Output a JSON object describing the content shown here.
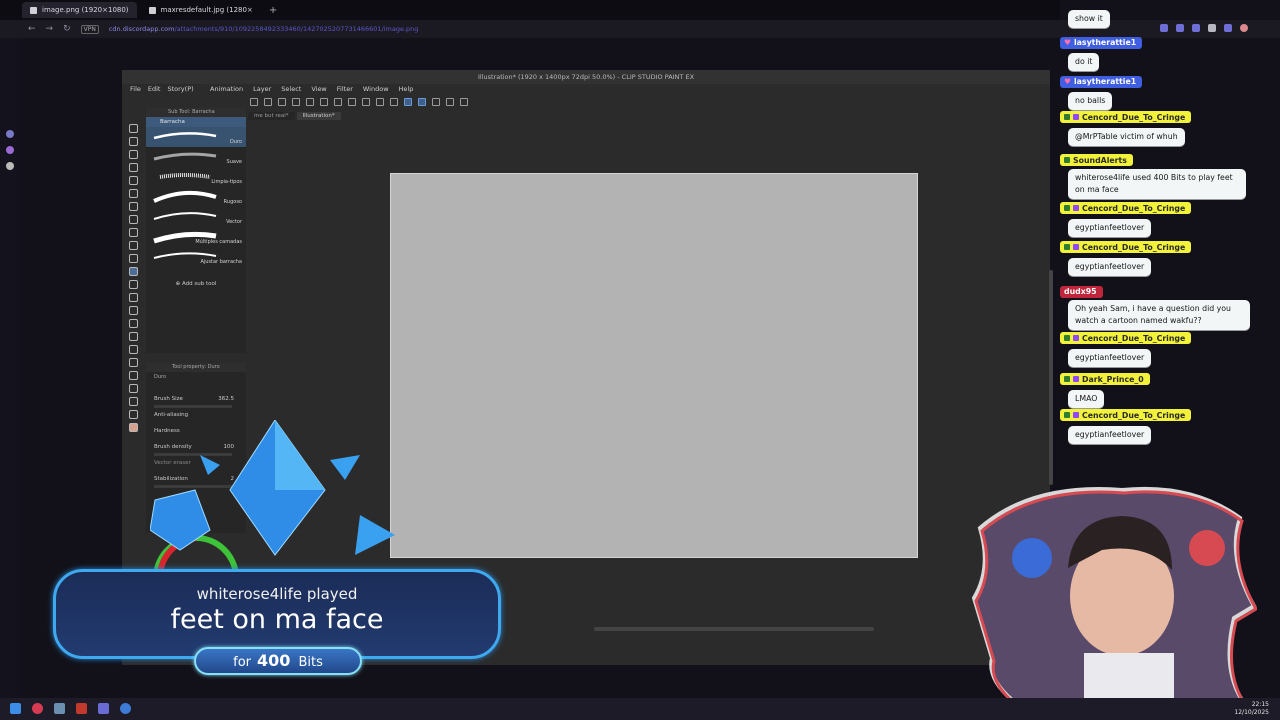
{
  "browser": {
    "tabs": [
      {
        "label": "image.png (1920×1080)",
        "active": true
      },
      {
        "label": "maxresdefault.jpg (1280×",
        "active": false
      }
    ],
    "new_tab": "+",
    "vpn_label": "VPN",
    "url_host": "cdn.discordapp.com",
    "url_path": "/attachments/910/1092258492333460/1427025207731466601/image.png"
  },
  "csp": {
    "title": "Illustration* (1920 x 1400px 72dpi 50.0%) - CLIP STUDIO PAINT EX",
    "menu": [
      "File",
      "Edit",
      "Story(P)",
      "Animation",
      "Layer",
      "Select",
      "View",
      "Filter",
      "Window",
      "Help"
    ],
    "doc_tabs": [
      "me but real*",
      "Illustration*"
    ],
    "subtool_header": "Sub Tool: Barracha",
    "subtool_group": "Barracha",
    "brushes": [
      "Duro",
      "Suave",
      "Limpia-tipos",
      "Rugoso",
      "Vector",
      "Múltiples camadas",
      "Ajustar barracha"
    ],
    "add_sub_tool": "Add sub tool",
    "tool_property_header": "Tool property: Duro",
    "tool_property_preset": "Duro",
    "props": {
      "brush_size_label": "Brush Size",
      "brush_size_value": "362.5",
      "anti_aliasing_label": "Anti-aliasing",
      "hardness_label": "Hardness",
      "brush_density_label": "Brush density",
      "brush_density_value": "100",
      "vector_eraser_label": "Vector eraser",
      "stabilization_label": "Stabilization",
      "stabilization_value": "2"
    }
  },
  "chat": {
    "messages": [
      {
        "user": "",
        "text": "show it",
        "style": "blue"
      },
      {
        "user": "lasytherattie1",
        "text": "do it",
        "style": "blue"
      },
      {
        "user": "lasytherattie1",
        "text": "no balls",
        "style": "blue"
      },
      {
        "user": "Cencord_Due_To_Cringe",
        "text": "@MrPTable victim of whuh",
        "style": "yellow"
      },
      {
        "user": "SoundAlerts",
        "text": "whiterose4life used 400 Bits to play feet on ma face",
        "style": "yellow"
      },
      {
        "user": "Cencord_Due_To_Cringe",
        "text": "egyptianfeetlover",
        "style": "yellow"
      },
      {
        "user": "Cencord_Due_To_Cringe",
        "text": "egyptianfeetlover",
        "style": "yellow"
      },
      {
        "user": "dudx95",
        "text": "Oh yeah Sam, i have a question did you watch a cartoon named wakfu??",
        "style": "red"
      },
      {
        "user": "Cencord_Due_To_Cringe",
        "text": "egyptianfeetlover",
        "style": "yellow"
      },
      {
        "user": "Dark_Prince_0",
        "text": "LMAO",
        "style": "yellow"
      },
      {
        "user": "Cencord_Due_To_Cringe",
        "text": "egyptianfeetlover",
        "style": "yellow"
      }
    ]
  },
  "alert": {
    "line1": "whiterose4life played",
    "line2": "feet on ma face",
    "for_label": "for",
    "amount": "400",
    "unit": "Bits"
  },
  "taskbar": {
    "time": "22:15",
    "date": "12/10/2025"
  },
  "colors": {
    "alert_border": "#3fa9f0",
    "chat_yellow": "#f2f23a",
    "chat_blue": "#3f5fe0",
    "chat_red": "#c0263b",
    "canvas": "#b3b3b3"
  }
}
